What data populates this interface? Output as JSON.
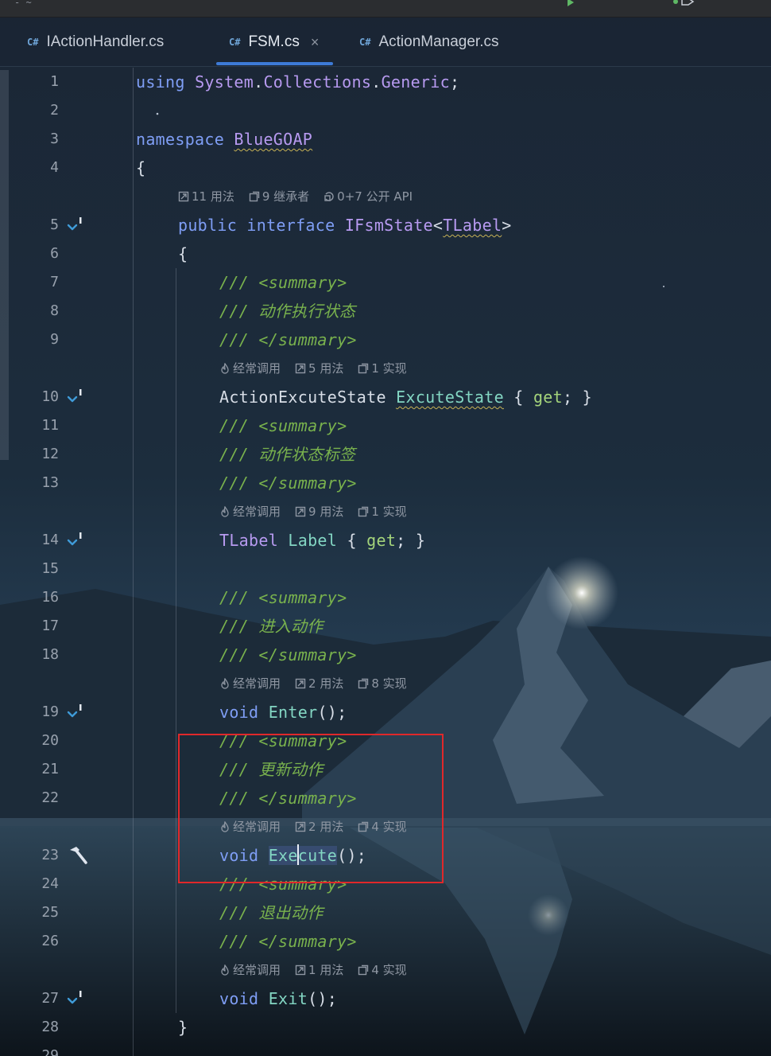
{
  "tabs": [
    {
      "lang": "C#",
      "name": "IActionHandler.cs",
      "active": false
    },
    {
      "lang": "C#",
      "name": "FSM.cs",
      "active": true,
      "close": "×"
    },
    {
      "lang": "C#",
      "name": "ActionManager.cs",
      "active": false
    }
  ],
  "hints": {
    "interface": [
      "11 用法",
      "9 继承者",
      "0+7 公开 API"
    ],
    "excute_state": [
      "经常调用",
      "5 用法",
      "1 实现"
    ],
    "label": [
      "经常调用",
      "9 用法",
      "1 实现"
    ],
    "enter": [
      "经常调用",
      "2 用法",
      "8 实现"
    ],
    "execute": [
      "经常调用",
      "2 用法",
      "4 实现"
    ],
    "exit": [
      "经常调用",
      "1 用法",
      "4 实现"
    ]
  },
  "comments": {
    "summary_open": "/// <summary>",
    "summary_close": "/// </summary>",
    "excute_state": "/// 动作执行状态",
    "label": "/// 动作状态标签",
    "enter": "/// 进入动作",
    "execute": "/// 更新动作",
    "exit": "/// 退出动作"
  },
  "line_numbers": [
    "1",
    "2",
    "3",
    "4",
    "5",
    "6",
    "7",
    "8",
    "9",
    "10",
    "11",
    "12",
    "13",
    "14",
    "15",
    "16",
    "17",
    "18",
    "19",
    "20",
    "21",
    "22",
    "23",
    "24",
    "25",
    "26",
    "27",
    "28",
    "29"
  ],
  "colors": {
    "keyword": "#7f9ef5",
    "type": "#b79af0",
    "member": "#83d6c3",
    "accessor": "#a4d47b",
    "comment": "#79b24d",
    "highlight_box": "#e0282a",
    "active_tab_underline": "#3d7ad6"
  }
}
